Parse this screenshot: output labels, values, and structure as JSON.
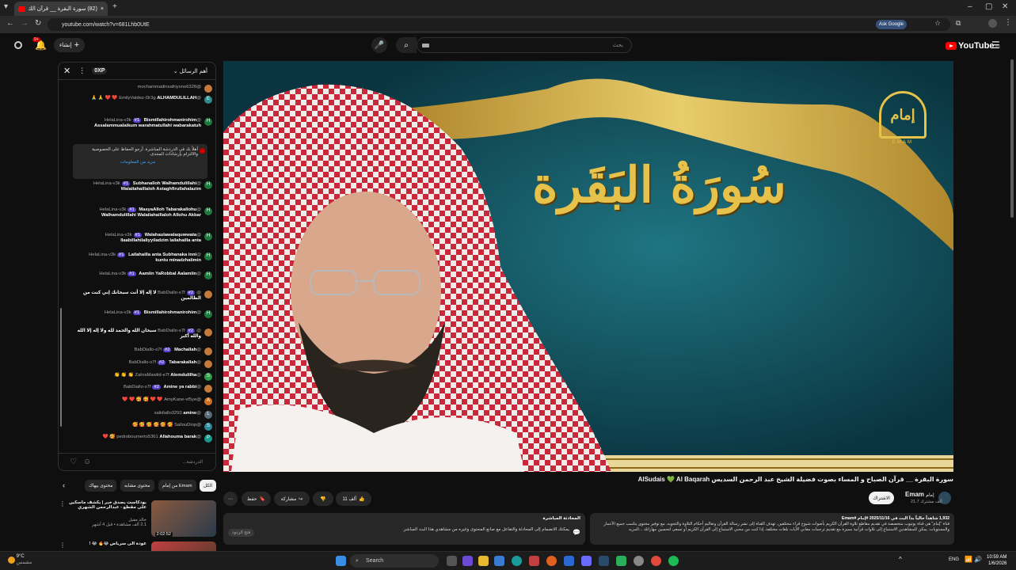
{
  "browser": {
    "tab_title": "(82) سورة البقرة __ قرآن الك...",
    "url": "youtube.com/watch?v=681Lhb0UtE",
    "ask_google": "Ask Google"
  },
  "header": {
    "create_label": "إنشاء",
    "notifications_count": "9+",
    "search_placeholder": "بحث",
    "logo_text": "YouTube",
    "country_code": "EG"
  },
  "chat": {
    "header_label": "أهم الرسائل",
    "points_label": "0XP",
    "first_user": "@mochammadinsafriyono6328",
    "messages": [
      {
        "author": "@EmilyValdez-l3r3g",
        "badge": "",
        "text": "ALHAMDULILLAH ❤️ ❤️ 🙏 🙏",
        "avatar": "E",
        "color": "#2e8b8b"
      },
      {
        "author": "@HelaLina-v3k",
        "badge": "#1",
        "text": "Bismillahirohmanirohim Assalammualaikum warahmatullahi wabarakatuh",
        "avatar": "H",
        "color": "#1e7a3c"
      },
      {
        "author": "@HelaLina-v3k",
        "badge": "#1",
        "text": "Subhanalloh Walhamdulillahi Walailahaillaloh Astaghfirullahalazim",
        "avatar": "H",
        "color": "#1e7a3c"
      },
      {
        "author": "@HelaLina-v3k",
        "badge": "#1",
        "text": "MasyaAlloh Tabarakallohu Walhamdulillahi Walailahaillaloh Allohu Akbar",
        "avatar": "H",
        "color": "#1e7a3c"
      },
      {
        "author": "@HelaLina-v3k",
        "badge": "#1",
        "text": "Walahaulawalaquwwata Ilaabillahilaliyyiladzim lailahailla anta",
        "avatar": "H",
        "color": "#1e7a3c"
      },
      {
        "author": "@HelaLina-v3k",
        "badge": "#1",
        "text": "Lailahailla anta Subhanaka inni kuntu minadzhalimin",
        "avatar": "H",
        "color": "#1e7a3c"
      },
      {
        "author": "@HelaLina-v3k",
        "badge": "#1",
        "text": "Aamiin YaRobbal Aalamiin",
        "avatar": "H",
        "color": "#1e7a3c"
      },
      {
        "author": "@BabDiallo-s7f",
        "badge": "#2",
        "text": "لا إله إلا أنت سبحانك إني كنت من الظالمين",
        "avatar": "",
        "color": "#c47a3a"
      },
      {
        "author": "@HelaLina-v3k",
        "badge": "#1",
        "text": "Bismillahirohmanirohim",
        "avatar": "H",
        "color": "#1e7a3c"
      },
      {
        "author": "@BabDiallo-s7f",
        "badge": "#2",
        "text": "سبحان الله والحمد لله ولا إله إلا الله والله أكبر",
        "avatar": "",
        "color": "#c47a3a"
      },
      {
        "author": "@BabDiallo-s7f",
        "badge": "#2",
        "text": "Machallah",
        "avatar": "",
        "color": "#c47a3a"
      },
      {
        "author": "@BabDiallo-s7f",
        "badge": "#2",
        "text": "Tabarakallah",
        "avatar": "",
        "color": "#c47a3a"
      },
      {
        "author": "@ZahraMawlid-e7f",
        "badge": "",
        "text": "Alemdulilha 👏 👏 👏",
        "avatar": "S",
        "color": "#2e9c4a"
      },
      {
        "author": "@BabDiallo-s7f",
        "badge": "#2",
        "text": "Amine ya rabbi",
        "avatar": "",
        "color": "#c47a3a"
      },
      {
        "author": "@AmyKane-vf5ye",
        "badge": "",
        "text": "❤️ ❤️ 🥰 🥰 ❤️ ❤️",
        "avatar": "A",
        "color": "#d07020"
      },
      {
        "author": "@salidiallo3293",
        "badge": "",
        "text": "amine",
        "avatar": "L",
        "color": "#5a6a7a"
      },
      {
        "author": "@SallouDiop",
        "badge": "",
        "text": "🥰 🥰 🥰 🥰 🥰 🥰",
        "avatar": "S",
        "color": "#2a8a9a"
      },
      {
        "author": "@pedrobournerto5361",
        "badge": "",
        "text": "Allahouma barak 🥰 ❤️",
        "avatar": "P",
        "color": "#1a9a8a"
      }
    ],
    "notice_text": "أهلاً بك في الدردشة المباشرة. أرجو الحفاظ على الخصوصية والالتزام بإرشادات المنتدى.",
    "notice_link": "مزيد من المعلومات",
    "input_placeholder": "الدردشة..."
  },
  "video": {
    "title": "سورة البقرة __ قرآن الصباح و المساء بصوت فضيلة الشيخ عبد الرحمن السديس AlSudais 💚 Al Baqarah",
    "overlay_text": "سُورَةُ البَقَرة",
    "brand_text": "إمام",
    "brand_sub": "EMAM"
  },
  "channel": {
    "name": "Emam",
    "name_ar": "إمام",
    "subs": "21.7 ألف مشترك",
    "subscribe_label": "الاشتراك"
  },
  "actions": {
    "likes": "11 ألف",
    "share": "مشاركة",
    "save": "حفظ"
  },
  "description": {
    "stats": "1,932 شاهداً حالياً  بدأ البث في 2025/11/16  #إمام #Emam",
    "text": "قناة \"إمام\" هي قناة يوتيوب متخصصة في تقديم مقاطع تلاوة القرآن الكريم بأصوات شيوخ قراء مختلفين. تهدف القناة إلى نشر رسالة القرآن وتعاليم أحكام التلاوة والتجويد، مع توفير محتوى يناسب جميع الأعمار والمستويات. يمكن للمشاهدين الاستماع إلى تلاوات قرآنية مميزة مع تقديم ترجمات معاني الآيات بلغات مختلفة. إذا كنت من محبي الاستماع إلى القرآن الكريم أو تسعى لتحسين مهاراتك ...المزيد"
  },
  "livechat_box": {
    "title": "المحادثة المباشرة",
    "text": "يمكنك الانضمام إلى المحادثة والتفاعل مع صانع المحتوى وغيره من مشاهدي هذا البث المباشر.",
    "button": "فتح الردود"
  },
  "related": {
    "chips": [
      "الكل",
      "من إمام Emam",
      "محتوى مشابه",
      "محتوى بيهاك"
    ],
    "items": [
      {
        "title": "بودكاست يصدق خير | يكشف ماسكين على مقطع - عبدالرحمن الشهري",
        "channel": "خالد مقيل",
        "meta": "2.1 ألف مشاهدة • قبل 4 أشهر",
        "duration": "2:02:52"
      },
      {
        "title": "عودة الى سرياض 😂🔥 😂 !",
        "channel": "",
        "meta": "",
        "duration": ""
      }
    ]
  },
  "taskbar": {
    "weather_temp": "9°C",
    "weather_desc": "مشمس",
    "search_label": "Search",
    "lang": "ENG",
    "time": "10:59 AM",
    "date": "1/6/2026"
  }
}
